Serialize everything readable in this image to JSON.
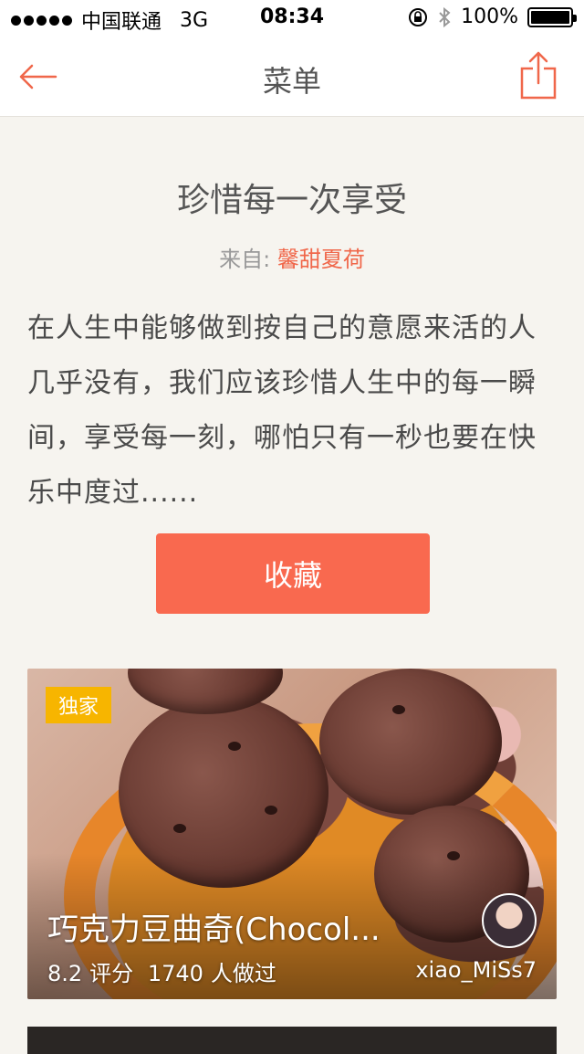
{
  "status_bar": {
    "carrier": "中国联通",
    "network": "3G",
    "time": "08:34",
    "battery": "100%"
  },
  "nav": {
    "title": "菜单",
    "back_icon": "back-arrow-icon",
    "share_icon": "share-icon"
  },
  "menu": {
    "title": "珍惜每一次享受",
    "source_label": "来自:",
    "author": "馨甜夏荷",
    "description": "在人生中能够做到按自己的意愿来活的人几乎没有，我们应该珍惜人生中的每一瞬间，享受每一刻，哪怕只有一秒也要在快乐中度过......",
    "collect_button": "收藏"
  },
  "recipe": {
    "badge": "独家",
    "name": "巧克力豆曲奇(Chocol...",
    "rating": "8.2",
    "rating_label": "评分",
    "made_count": "1740",
    "made_label": "人做过",
    "author": "xiao_MiSs7"
  },
  "colors": {
    "accent": "#f9694f",
    "badge": "#f7b500",
    "background": "#f6f4ef"
  }
}
